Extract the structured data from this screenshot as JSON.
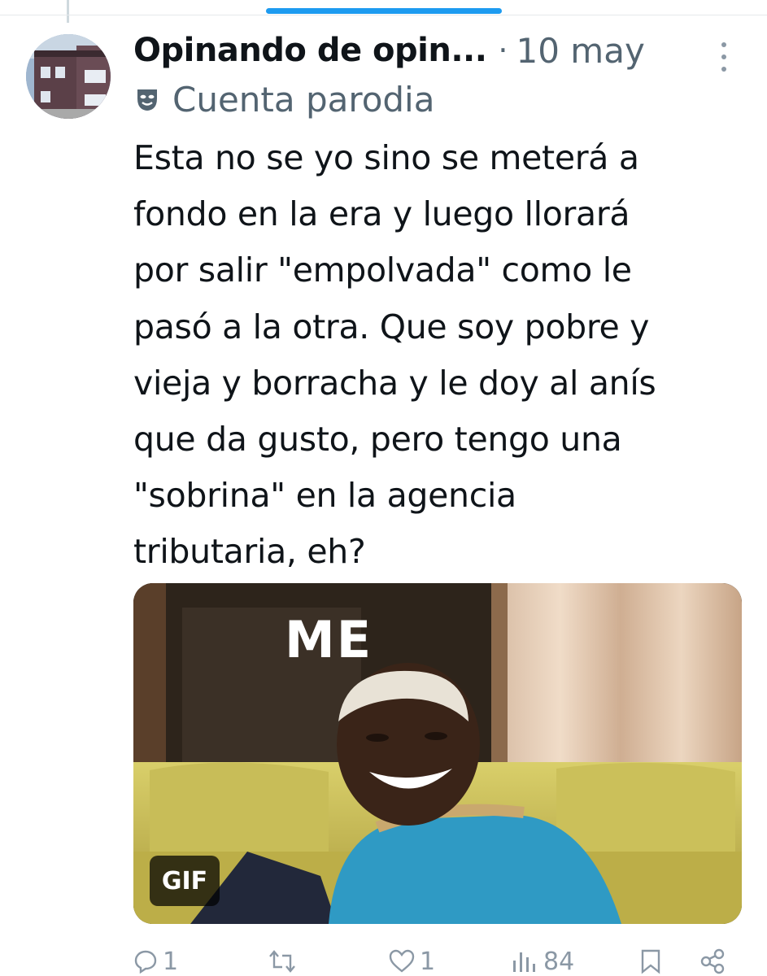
{
  "tweet": {
    "author_name": "Opinando de opin...",
    "separator": "·",
    "timestamp": "10 may",
    "parody_label": "Cuenta parodia",
    "text": "Esta no se yo sino se meterá a\nfondo en la era y luego llorará\npor salir \"empolvada\" como le\npasó a la otra. Que soy pobre y\nvieja y borracha y le doy al anís\nque da gusto, pero tengo una\n\"sobrina\" en la agencia\ntributaria, eh?",
    "media": {
      "caption": "ME",
      "badge": "GIF"
    },
    "actions": {
      "replies": "1",
      "reposts": "",
      "likes": "1",
      "views": "84"
    }
  },
  "icons": {
    "more": "more-vertical-icon",
    "parody": "theater-mask-icon",
    "reply": "reply-icon",
    "repost": "repost-icon",
    "like": "heart-icon",
    "views": "views-chart-icon",
    "bookmark": "bookmark-icon",
    "share": "share-icon"
  },
  "colors": {
    "accent": "#1d9bf0",
    "text": "#0f1419",
    "secondary": "#536471",
    "icon_gray": "#8b98a5"
  }
}
